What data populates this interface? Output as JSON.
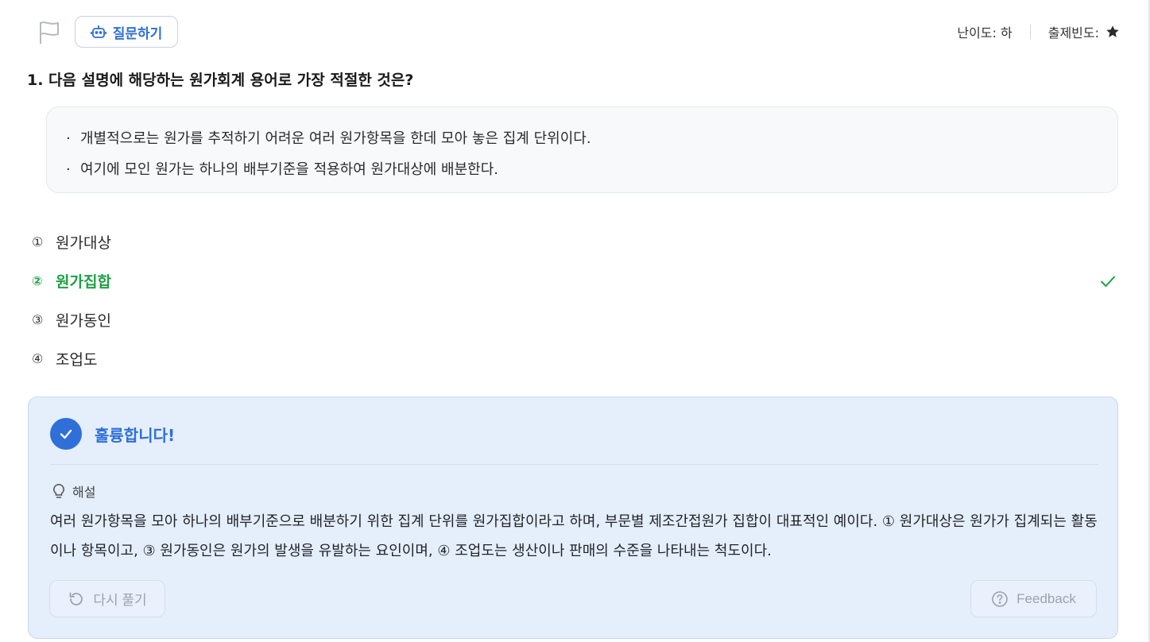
{
  "toolbar": {
    "ask_label": "질문하기",
    "difficulty": "난이도: 하",
    "frequency": "출제빈도:"
  },
  "question": {
    "text": "1. 다음 설명에 해당하는 원가회계 용어로 가장 적절한 것은?",
    "description": [
      "개별적으로는 원가를 추적하기 어려운 여러 원가항목을 한데 모아 놓은 집계 단위이다.",
      "여기에 모인 원가는 하나의 배부기준을 적용하여 원가대상에 배분한다."
    ],
    "bullet": "·"
  },
  "options": [
    {
      "num": "①",
      "label": "원가대상"
    },
    {
      "num": "②",
      "label": "원가집합"
    },
    {
      "num": "③",
      "label": "원가동인"
    },
    {
      "num": "④",
      "label": "조업도"
    }
  ],
  "result": {
    "title": "훌륭합니다!",
    "explain_label": "해설",
    "explanation": "여러 원가항목을 모아 하나의 배부기준으로 배분하기 위한 집계 단위를 원가집합이라고 하며, 부문별 제조간접원가 집합이 대표적인 예이다. ① 원가대상은 원가가 집계되는 활동이나 항목이고, ③ 원가동인은 원가의 발생을 유발하는 요인이며, ④ 조업도는 생산이나 판매의 수준을 나타내는 척도이다.",
    "retry_label": "다시 풀기",
    "feedback_label": "Feedback"
  },
  "colors": {
    "accent": "#2e6fd8",
    "correct": "#1ea043",
    "result_bg": "#e5eefb"
  },
  "icons": [
    "flag-icon",
    "robot-icon",
    "star-icon",
    "check-icon",
    "lightbulb-icon",
    "retry-icon",
    "help-circle-icon"
  ]
}
